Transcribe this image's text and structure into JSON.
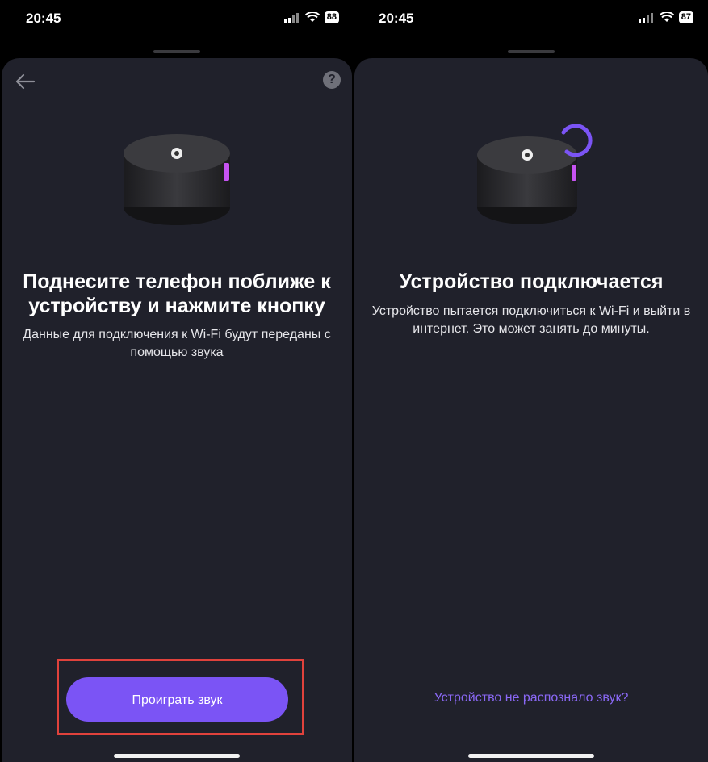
{
  "left": {
    "status": {
      "time": "20:45",
      "battery": "88"
    },
    "title": "Поднесите телефон поближе к устройству и нажмите кнопку",
    "subtitle": "Данные для подключения к Wi-Fi будут переданы с помощью звука",
    "primary_button": "Проиграть звук",
    "icons": {
      "back": "arrow-left-icon",
      "help": "question-circle-icon",
      "help_glyph": "?"
    }
  },
  "right": {
    "status": {
      "time": "20:45",
      "battery": "87"
    },
    "title": "Устройство подключается",
    "subtitle": "Устройство пытается подключиться к Wi-Fi и выйти в интернет. Это может занять до минуты.",
    "link": "Устройство не распознало звук?"
  },
  "colors": {
    "accent": "#7b54f5",
    "sheet": "#20212b",
    "highlight": "#e0423c",
    "link": "#8a68f5"
  }
}
